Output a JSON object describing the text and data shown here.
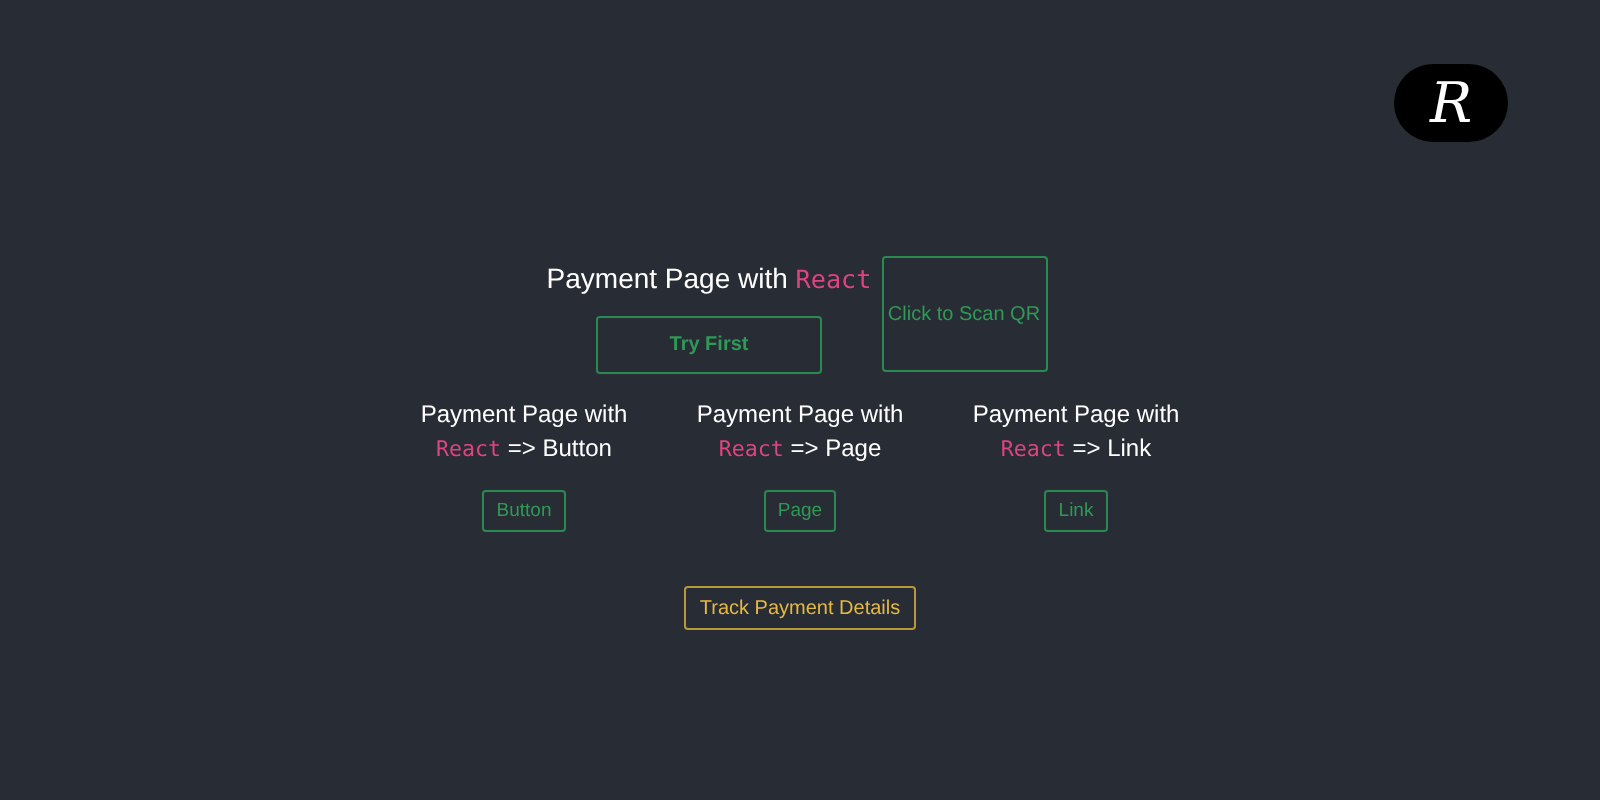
{
  "logo": {
    "letter": "R"
  },
  "title": {
    "text": "Payment Page with",
    "code": "React"
  },
  "try_button": "Try First",
  "qr_button": "Click to Scan QR",
  "columns": [
    {
      "text": "Payment Page with",
      "code": "React",
      "rest": "=> Button",
      "button": "Button"
    },
    {
      "text": "Payment Page with",
      "code": "React",
      "rest": "=> Page",
      "button": "Page"
    },
    {
      "text": "Payment Page with",
      "code": "React",
      "rest": "=> Link",
      "button": "Link"
    }
  ],
  "track_button": "Track Payment Details"
}
